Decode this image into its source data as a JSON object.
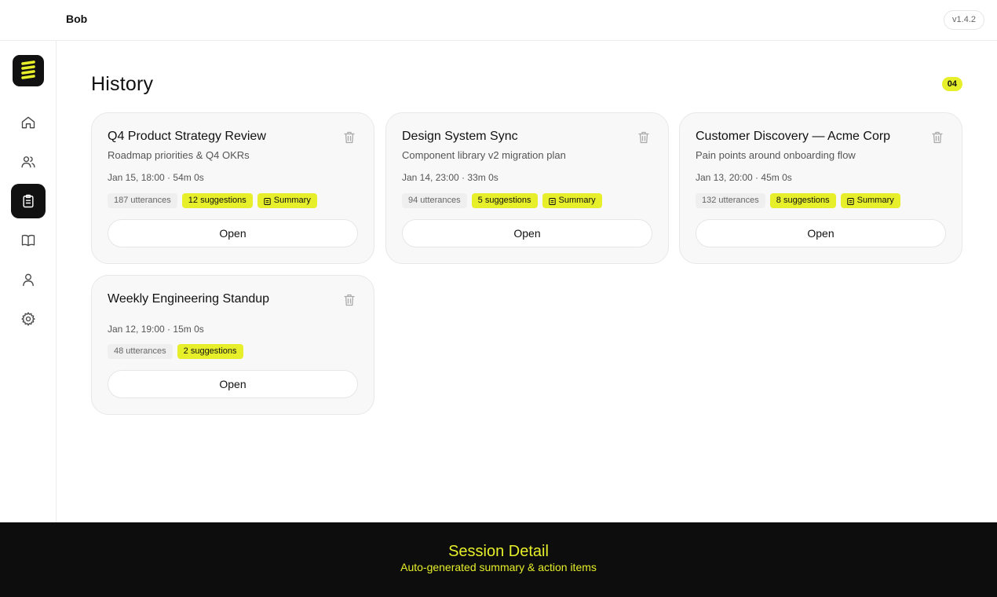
{
  "header": {
    "user": "Bob",
    "version": "v1.4.2"
  },
  "sidebar": {
    "items": [
      {
        "name": "home",
        "icon": "home-icon",
        "active": false
      },
      {
        "name": "people",
        "icon": "users-icon",
        "active": false
      },
      {
        "name": "history",
        "icon": "clipboard-icon",
        "active": true
      },
      {
        "name": "library",
        "icon": "book-icon",
        "active": false
      },
      {
        "name": "profile",
        "icon": "user-icon",
        "active": false
      },
      {
        "name": "settings",
        "icon": "gear-icon",
        "active": false
      }
    ]
  },
  "main": {
    "title": "History",
    "count": "04",
    "sessions": [
      {
        "title": "Q4 Product Strategy Review",
        "subtitle": "Roadmap priorities & Q4 OKRs",
        "meta": "Jan 15, 18:00 · 54m 0s",
        "utterances": "187 utterances",
        "suggestions": "12 suggestions",
        "summary": "Summary",
        "open": "Open"
      },
      {
        "title": "Design System Sync",
        "subtitle": "Component library v2 migration plan",
        "meta": "Jan 14, 23:00 · 33m 0s",
        "utterances": "94 utterances",
        "suggestions": "5 suggestions",
        "summary": "Summary",
        "open": "Open"
      },
      {
        "title": "Customer Discovery — Acme Corp",
        "subtitle": "Pain points around onboarding flow",
        "meta": "Jan 13, 20:00 · 45m 0s",
        "utterances": "132 utterances",
        "suggestions": "8 suggestions",
        "summary": "Summary",
        "open": "Open"
      },
      {
        "title": "Weekly Engineering Standup",
        "subtitle": "",
        "meta": "Jan 12, 19:00 · 15m 0s",
        "utterances": "48 utterances",
        "suggestions": "2 suggestions",
        "summary": "",
        "open": "Open"
      }
    ]
  },
  "footer": {
    "title": "Session Detail",
    "subtitle": "Auto-generated summary & action items"
  },
  "colors": {
    "accent": "#e6ef2a",
    "dark": "#111111",
    "card_bg": "#f8f8f8",
    "footer_bg": "#0d0d0d"
  }
}
